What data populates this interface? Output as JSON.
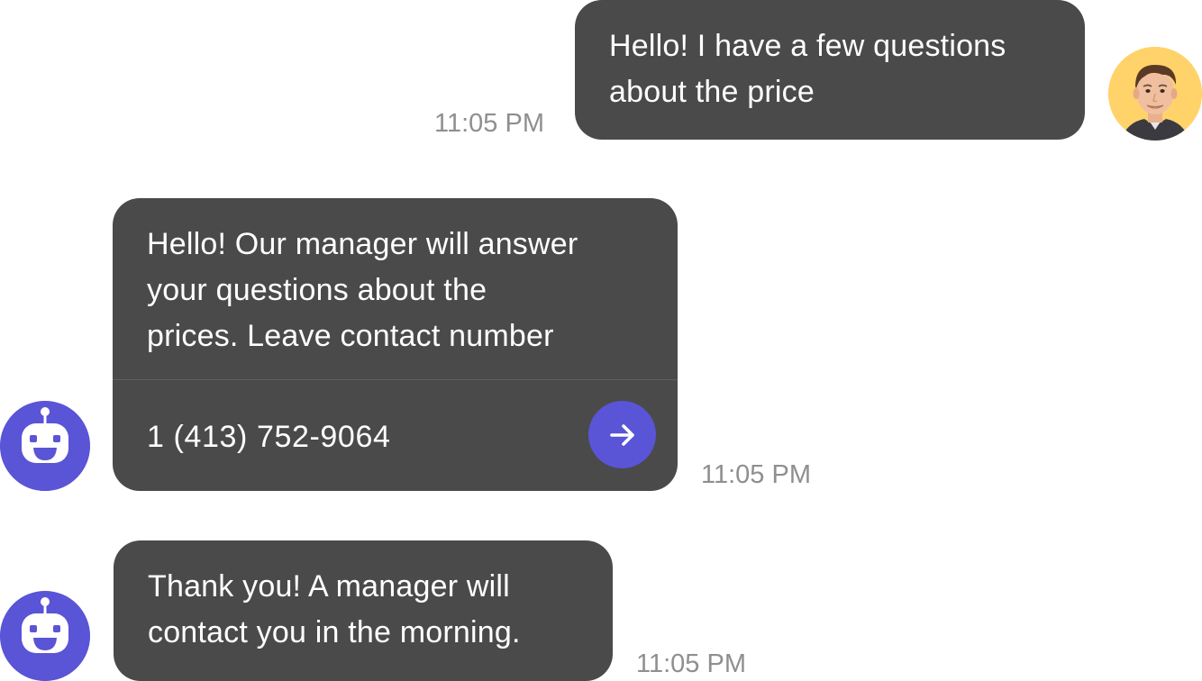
{
  "messages": [
    {
      "sender": "user",
      "text_lines": [
        "Hello! I have a few questions",
        "about the price"
      ],
      "time": "11:05 PM"
    },
    {
      "sender": "bot",
      "text_lines": [
        "Hello! Our manager will answer",
        "your questions about the",
        "prices. Leave contact number"
      ],
      "input": {
        "value": "1 (413) 752-9064",
        "send_icon": "arrow-right-icon"
      },
      "time": "11:05 PM"
    },
    {
      "sender": "bot",
      "text_lines": [
        "Thank you! A manager will",
        "contact you in the morning."
      ],
      "time": "11:05 PM"
    }
  ],
  "avatars": {
    "user": "user-photo-avatar",
    "bot": "robot-icon"
  },
  "colors": {
    "bubble": "#4a4a4a",
    "accent": "#5a54d6",
    "timestamp": "#8f8f8f",
    "user_avatar_bg": "#ffd36a"
  }
}
